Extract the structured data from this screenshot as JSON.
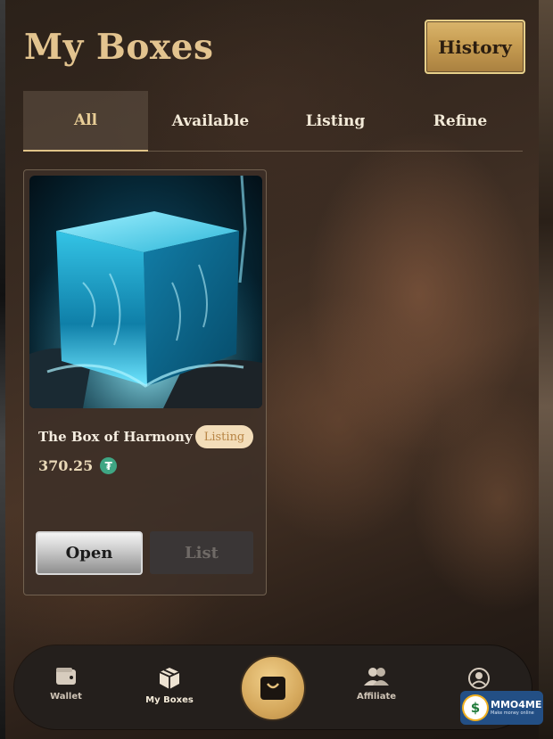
{
  "header": {
    "title": "My Boxes",
    "history_label": "History"
  },
  "tabs": [
    {
      "label": "All",
      "active": true
    },
    {
      "label": "Available",
      "active": false
    },
    {
      "label": "Listing",
      "active": false
    },
    {
      "label": "Refine",
      "active": false
    }
  ],
  "boxes": [
    {
      "name": "The Box of Harmony",
      "status": "Listing",
      "price": "370.25",
      "currency_icon": "tether-token-icon",
      "open_label": "Open",
      "list_label": "List",
      "image": "glowing-ice-cube"
    }
  ],
  "bottom_nav": {
    "items": [
      {
        "label": "Wallet",
        "icon": "wallet-icon",
        "active": false
      },
      {
        "label": "My Boxes",
        "icon": "box-icon",
        "active": true
      },
      {
        "label": "",
        "icon": "shopping-bag-icon",
        "active": false
      },
      {
        "label": "Affiliate",
        "icon": "users-icon",
        "active": false
      },
      {
        "label": "",
        "icon": "user-profile-icon",
        "active": false
      }
    ]
  },
  "watermark": {
    "brand": "MMO4ME",
    "tagline": "Make money online"
  },
  "colors": {
    "accent_gold": "#e3c48f",
    "history_button": "#c79d52",
    "listing_badge_bg": "#f3ddb9",
    "token_green": "#3fa684",
    "nav_bg": "#241f1c"
  }
}
